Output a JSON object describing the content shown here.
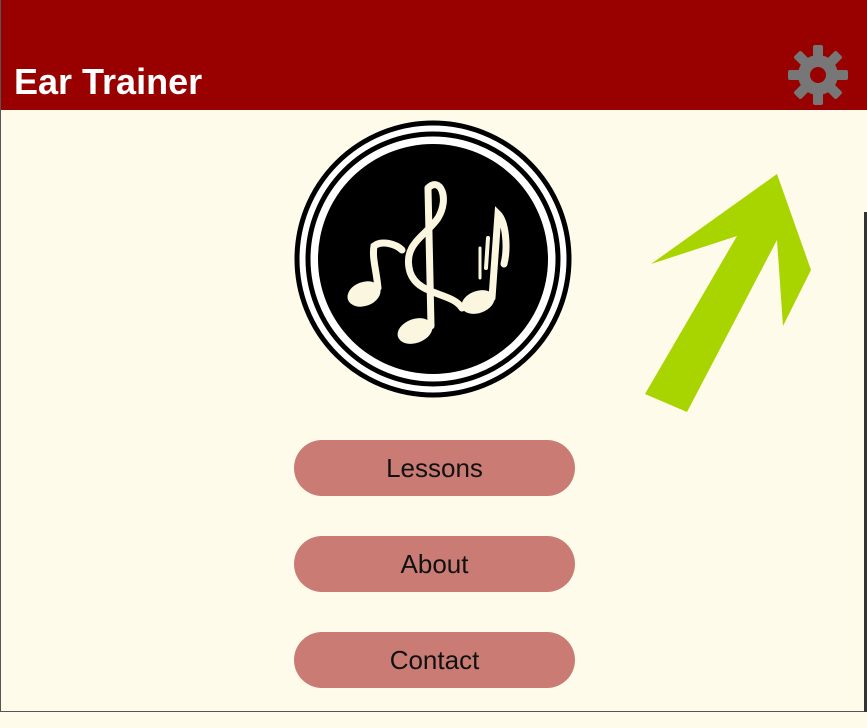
{
  "app": {
    "title": "Ear Trainer"
  },
  "header": {
    "background_color": "#990000",
    "settings_icon": "gear-icon"
  },
  "logo": {
    "icon": "music-notes-logo"
  },
  "annotation": {
    "icon": "arrow-up-right-icon",
    "color": "#a8d400"
  },
  "menu": {
    "button_color": "#ca7c74",
    "items": [
      {
        "label": "Lessons"
      },
      {
        "label": "About"
      },
      {
        "label": "Contact"
      }
    ]
  }
}
